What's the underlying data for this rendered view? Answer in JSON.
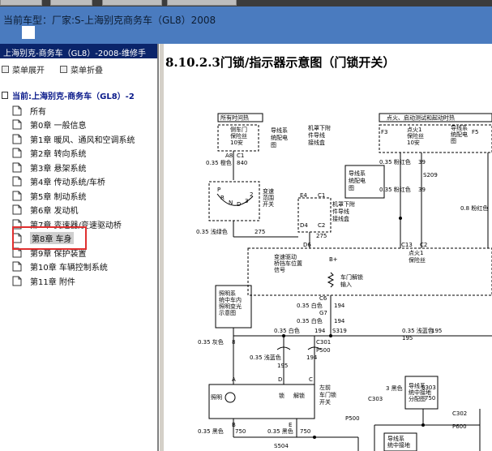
{
  "window": {
    "vehicle_label": "当前车型：厂家:S-上海别克商务车（GL8）2008"
  },
  "tree": {
    "header": "上海别克-商务车（GL8）-2008-维修手",
    "expand_label": "菜单展开",
    "collapse_label": "菜单折叠",
    "root_label": "当前:上海别克-商务车（GL8）-2",
    "items": [
      {
        "label": "所有"
      },
      {
        "label": "第0章 一般信息"
      },
      {
        "label": "第1章 暖风、通风和空调系统"
      },
      {
        "label": "第2章 转向系统"
      },
      {
        "label": "第3章 悬架系统"
      },
      {
        "label": "第4章 传动系统/车桥"
      },
      {
        "label": "第5章 制动系统"
      },
      {
        "label": "第6章 发动机"
      },
      {
        "label": "第7章 变速器/变速驱动桥"
      },
      {
        "label": "第8章 车身"
      },
      {
        "label": "第9章 保护装置"
      },
      {
        "label": "第10章 车辆控制系统"
      },
      {
        "label": "第11章 附件"
      }
    ],
    "selected_index": 9
  },
  "content": {
    "title": "8.10.2.3门锁/指示器示意图（门锁开关）"
  },
  "diagram": {
    "hot_all": "所有时间热",
    "hot_run": "点火、启动测试和起动时热",
    "fuse_box_left": [
      "侧车门",
      "保险丝",
      "10安"
    ],
    "fuse_left_ref": [
      "导线系",
      "统配电",
      "图"
    ],
    "junction_right": [
      "机罩下附",
      "件导线",
      "接线盒"
    ],
    "fuse_f3": "F3",
    "fuse_f5": "F5",
    "fuse_mid": [
      "点火1",
      "保险丝",
      "10安"
    ],
    "fuse_right": [
      "点火1",
      "保险丝"
    ],
    "fuse_mid_ref": [
      "导线系",
      "统配电",
      "图"
    ],
    "wire_labels": {
      "a8_c1": "A8",
      "wire_840": "0.35 橙色",
      "c1_840": "C1",
      "n840": "840",
      "s209": "S209",
      "wire_39": "0.35 粉红色",
      "n39": "39",
      "wire_39b": "0.35 粉红色",
      "n39b": "39",
      "wire_08": "0.8 粉红色",
      "wire_275": "0.35 浅绿色",
      "n275": "275",
      "n275b": "275",
      "c2": "C2",
      "c13": "C13",
      "e4": "E4",
      "c1b": "C1",
      "d4": "D4",
      "c2b": "C2",
      "d6": "D6",
      "b_plus": "B+",
      "c6": "C6",
      "wire_194a": "0.35 白色",
      "n194a": "194",
      "g7": "G7",
      "wire_194b": "0.35 白色",
      "n194b": "194",
      "s319": "S319",
      "wire_194c": "0.35 白色",
      "n194c": "194",
      "wire_194d": "0.35 浅蓝色",
      "n195": "195",
      "wire_8": "0.35 灰色",
      "n8": "8",
      "c301": "C301",
      "p500": "P500",
      "wire_195": "0.35 浅蓝色",
      "n195b": "195",
      "n194e": "194",
      "wire_750a": "0.35 黑色",
      "n750a": "750",
      "wire_750b": "0.35 黑色",
      "n750b": "750",
      "s504": "S504",
      "s303": "S303",
      "c303": "C303",
      "c302": "C302",
      "p600": "P600",
      "p500b": "P500",
      "wire_3black": "3 黑色",
      "n750c": "750"
    },
    "range_switch": [
      "变速",
      "范围",
      "开关"
    ],
    "range_letters": [
      "P",
      "R",
      "N",
      "D",
      "3",
      "2"
    ],
    "underhood_box": [
      "机罩下附",
      "件导线",
      "接线盒"
    ],
    "lamp_ref": [
      "照明系",
      "统中车内",
      "照明变光",
      "示意图"
    ],
    "ctrl_module": [
      "变速驱动",
      "桥挡车位置",
      "信号"
    ],
    "door_lock_input": [
      "车门解锁",
      "输入"
    ],
    "wiring_ref": [
      "导线系",
      "统配电",
      "图"
    ],
    "ground_ref_a": [
      "导线系",
      "统中接地",
      "分配图"
    ],
    "ground_ref_b": [
      "导线系",
      "统中接地",
      "分配图"
    ],
    "door_switch": [
      "左前",
      "车门锁",
      "开关"
    ],
    "switch_labels": [
      "照明",
      "锁",
      "解锁"
    ],
    "pin_labels": [
      "A",
      "D",
      "C",
      "B",
      "E"
    ]
  }
}
